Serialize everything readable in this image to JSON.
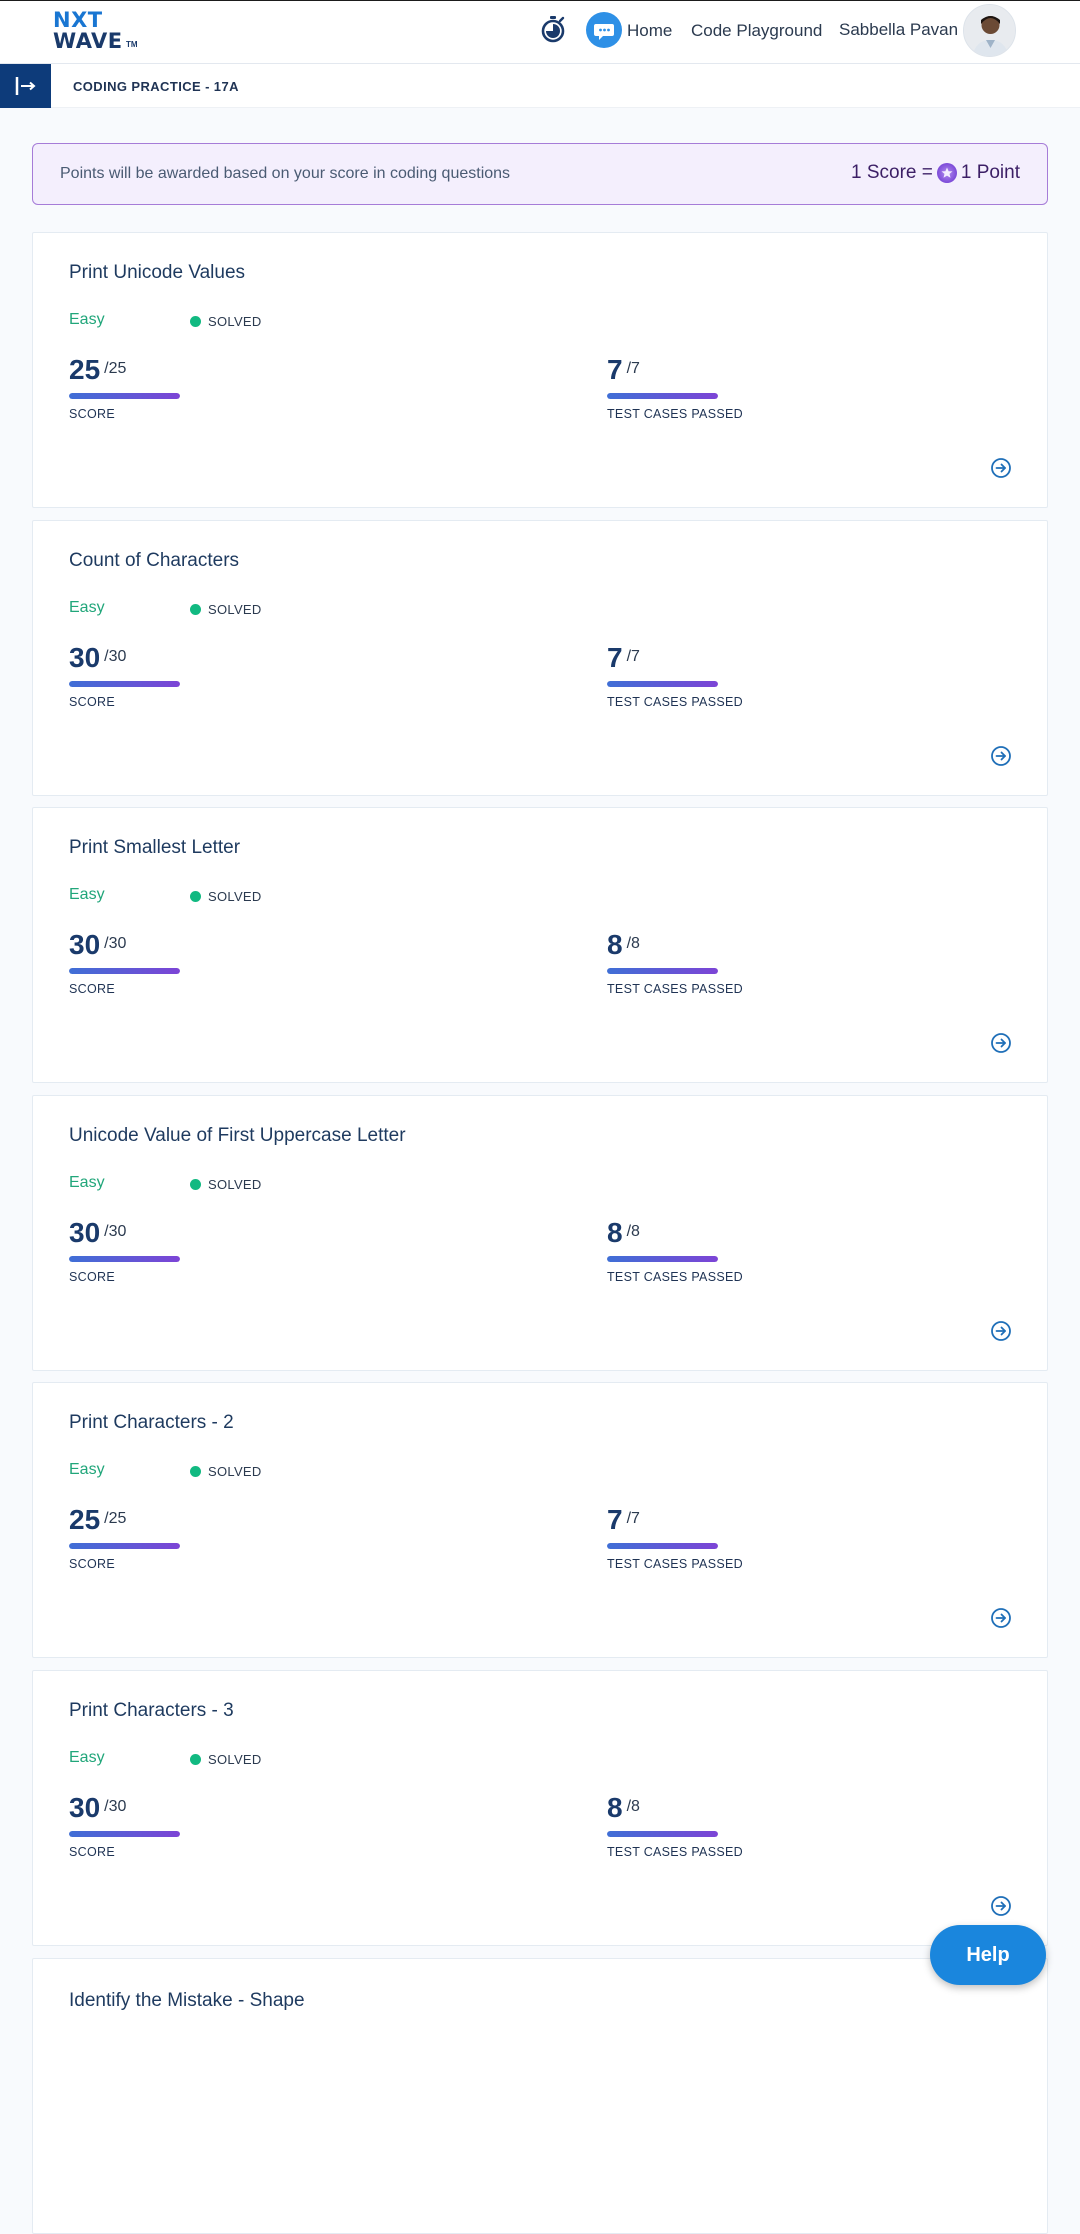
{
  "brand": {
    "line1": "NXT",
    "line2": "WAVE",
    "tm": "TM"
  },
  "nav": {
    "home": "Home",
    "code_playground": "Code Playground",
    "user_name": "Sabbella Pavan"
  },
  "breadcrumb": "CODING PRACTICE - 17A",
  "banner": {
    "text": "Points will be awarded based on your score in coding questions",
    "left": "1 Score =",
    "right": "1 Point"
  },
  "labels": {
    "score": "SCORE",
    "tests": "TEST CASES PASSED"
  },
  "questions": [
    {
      "title": "Print Unicode Values",
      "difficulty": "Easy",
      "status": "SOLVED",
      "score": "25",
      "score_max": "/25",
      "tests": "7",
      "tests_max": "/7",
      "score_fraction": 1,
      "tests_fraction": 1
    },
    {
      "title": "Count of Characters",
      "difficulty": "Easy",
      "status": "SOLVED",
      "score": "30",
      "score_max": "/30",
      "tests": "7",
      "tests_max": "/7",
      "score_fraction": 1,
      "tests_fraction": 1
    },
    {
      "title": "Print Smallest Letter",
      "difficulty": "Easy",
      "status": "SOLVED",
      "score": "30",
      "score_max": "/30",
      "tests": "8",
      "tests_max": "/8",
      "score_fraction": 1,
      "tests_fraction": 1
    },
    {
      "title": "Unicode Value of First Uppercase Letter",
      "difficulty": "Easy",
      "status": "SOLVED",
      "score": "30",
      "score_max": "/30",
      "tests": "8",
      "tests_max": "/8",
      "score_fraction": 1,
      "tests_fraction": 1
    },
    {
      "title": "Print Characters - 2",
      "difficulty": "Easy",
      "status": "SOLVED",
      "score": "25",
      "score_max": "/25",
      "tests": "7",
      "tests_max": "/7",
      "score_fraction": 1,
      "tests_fraction": 1
    },
    {
      "title": "Print Characters - 3",
      "difficulty": "Easy",
      "status": "SOLVED",
      "score": "30",
      "score_max": "/30",
      "tests": "8",
      "tests_max": "/8",
      "score_fraction": 1,
      "tests_fraction": 1
    }
  ],
  "partial_question": {
    "title": "Identify the Mistake - Shape"
  },
  "help_label": "Help",
  "colors": {
    "brand_blue": "#1976d2",
    "easy_green": "#21a67a",
    "solved_dot": "#11b981",
    "accent_purple": "#7d44d6",
    "help_blue": "#1a86dd"
  }
}
